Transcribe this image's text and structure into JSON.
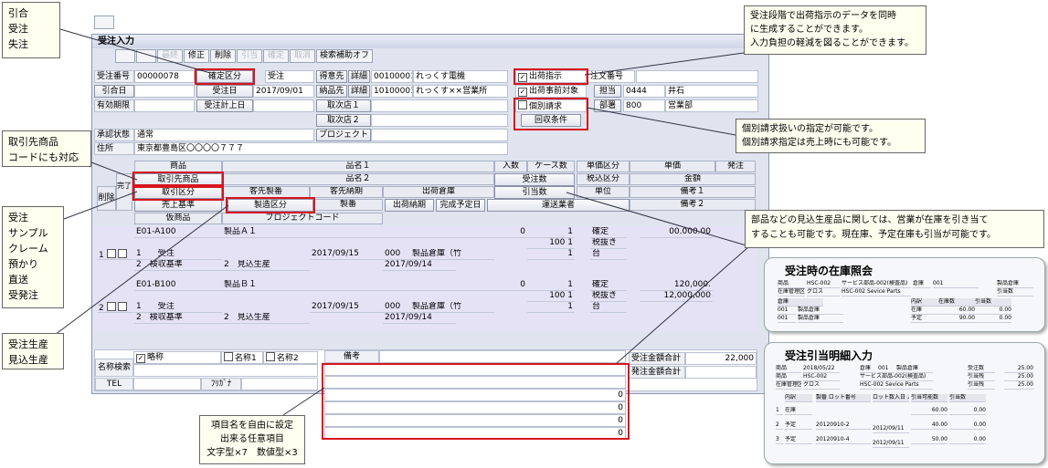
{
  "window": {
    "title": "受注入力",
    "toolbar": [
      "",
      "",
      "最終",
      "修正",
      "削除",
      "引当",
      "確定",
      "取消",
      "検索補助オフ"
    ]
  },
  "header": {
    "order_no_label": "受注番号",
    "order_no": "00000078",
    "kakutei_btn": "確定区分",
    "status": "受注",
    "tokuisaki_btn": "得意先",
    "detail1": "詳細",
    "tokuisaki_code": "00100001",
    "tokuisaki_name": "れっくす電機",
    "shukka_shiji": "出荷指示",
    "chumon_no": "注文番号",
    "hikiate_btn": "引合日",
    "juchu_date_btn": "受注日",
    "juchu_date": "2017/09/01",
    "nohin_btn": "納品先",
    "detail2": "詳細",
    "nohin_code": "10100001",
    "nohin_name": "れっくす××営業所",
    "shukka_taisho": "出荷事前対象",
    "tanto_btn": "担当",
    "tanto_code": "0444",
    "tanto_name": "井石",
    "yuko_label": "有効期限",
    "keijo_btn": "受注計上日",
    "torituki1_btn": "取次店１",
    "kobetsu": "個別請求",
    "bumon_btn": "部署",
    "bumon_code": "800",
    "bumon_name": "営業部",
    "torituki2_btn": "取次店２",
    "kaishu_btn": "回収条件",
    "project_btn": "プロジェクト",
    "shonin_label": "承認状態",
    "shonin_value": "通常",
    "jusho_label": "住所",
    "jusho_value": "東京都豊島区〇〇〇〇７７７"
  },
  "grid_headers": {
    "shohin": "商品",
    "hinmei1": "品名１",
    "irisu": "入数",
    "case": "ケース数",
    "tanka_kubun": "単価区分",
    "tanka": "単価",
    "hatchu": "発注",
    "torihiki_shohin": "取引先商品",
    "hinmei2": "品名２",
    "juchu_su": "受注数",
    "zeikomi": "税込区分",
    "kingaku": "金額",
    "sakujo": "削除",
    "kanryo": "完了",
    "torihiki_kubun": "取引区分",
    "kyaku_seiban": "客先製番",
    "kyaku_noki": "客先納期",
    "shukka_soko": "出荷倉庫",
    "hikiate_su": "引当数",
    "tani": "単位",
    "biko1": "備考１",
    "uriage_kijun": "売上基準",
    "seizo_kubun": "製造区分",
    "seiban": "製番",
    "shukka_noki": "出荷納期",
    "kansei": "完成予定日",
    "unso": "運送業者",
    "biko2": "備考２",
    "kari_shohin": "仮商品",
    "project_code": "プロジェクトコード"
  },
  "rows": [
    {
      "no": "1",
      "code": "E01-A100",
      "name": "製品Ａ１",
      "n1": "0",
      "n2": "0",
      "n3": "1",
      "kakutei": "確定",
      "tanka": "00.000.00",
      "n4": "100",
      "n5": "1",
      "zeinuki": "税抜き",
      "torihiki": "1",
      "torihiki_name": "受注",
      "date1": "2017/09/15",
      "soko_code": "000",
      "soko": "製品倉庫（竹",
      "n6": "0",
      "n7": "1",
      "tani": "台",
      "uriage": "2",
      "uriage_name": "検収基準",
      "seizo": "2",
      "seizo_name": "見込生産",
      "date2": "2017/09/14"
    },
    {
      "no": "2",
      "code": "E01-B100",
      "name": "製品Ｂ１",
      "n1": "0",
      "n2": "0",
      "n3": "1",
      "kakutei": "確定",
      "tanka": "120,000.",
      "n4": "100",
      "n5": "1",
      "zeinuki": "税抜き",
      "kingaku": "12,000,000",
      "torihiki": "1",
      "torihiki_name": "受注",
      "date1": "2017/09/15",
      "soko_code": "000",
      "soko": "製品倉庫（竹",
      "n6": "0",
      "n7": "1",
      "tani": "台",
      "uriage": "2",
      "uriage_name": "検収基準",
      "seizo": "2",
      "seizo_name": "見込生産",
      "date2": "2017/09/14"
    }
  ],
  "footer": {
    "meisho_label": "名称検索",
    "ryakusho": "略称",
    "meisho1": "名称1",
    "meisho2": "名称2",
    "tel": "TEL",
    "furigana": "ﾌﾘｶﾞﾅ",
    "biko": "備考",
    "juchu_total_label": "受注金額合計",
    "juchu_total": "22,000",
    "hatchu_total_label": "発注金額合計",
    "zeros": [
      "0",
      "0",
      "0",
      "0"
    ]
  },
  "notes": {
    "n1": [
      "引合",
      "受注",
      "失注"
    ],
    "n2": [
      "受注段階で出荷指示のデータを同時",
      "に生成することができます。",
      "入力負担の軽減を図ることができます。"
    ],
    "n3": [
      "取引先商品",
      "コードにも対応"
    ],
    "n4": [
      "個別請求扱いの指定が可能です。",
      "個別請求指定は売上時にも可能です。"
    ],
    "n5": [
      "受注",
      "サンプル",
      "クレーム",
      "預かり",
      "直送",
      "受発注"
    ],
    "n6": [
      "部品などの見込生産品に関しては、営業が在庫を引き当て",
      "することも可能です。現在庫、予定在庫も引当が可能です。"
    ],
    "n7": [
      "受注生産",
      "見込生産"
    ],
    "n8": [
      "項目名を自由に設定",
      "出来る任意項目",
      "文字型×7　数値型×3"
    ]
  },
  "shot1": {
    "caption": "受注時の在庫照会",
    "r1": [
      "商品",
      "HSC-002",
      "サービス部品-002(検査品)",
      "倉庫",
      "001",
      "製品倉庫"
    ],
    "r2": [
      "在庫管理区分",
      "グロス",
      "HSC-002 Sevice Parts",
      "",
      "引当数",
      ""
    ],
    "hdr": [
      "倉庫",
      "内訳",
      "在庫数",
      "引当数"
    ],
    "rows": [
      [
        "001",
        "製品倉庫",
        "在庫",
        "60.00",
        "0.00"
      ],
      [
        "001",
        "製品倉庫",
        "予定",
        "90.00",
        "0.00"
      ]
    ]
  },
  "shot2": {
    "caption": "受注引当明細入力",
    "r1": [
      "商品",
      "2018/05/22",
      "倉庫",
      "001",
      "製品倉庫",
      "受注数",
      "25.00"
    ],
    "r2": [
      "商品",
      "HSC-002",
      "サービス部品-002(検査品)",
      "引当残",
      "25.00"
    ],
    "r3": [
      "在庫管理区分",
      "グロス",
      "HSC-002 Sevice Parts",
      "引当残",
      "25.00"
    ],
    "hdr": [
      "内訳",
      "製番 ロット番号",
      "ロット数入日 入庫予定日",
      "引当可能数",
      "引当数"
    ],
    "rows": [
      [
        "1",
        "在庫",
        "",
        "",
        "60.00",
        "0.00"
      ],
      [
        "2",
        "予定",
        "20120910-2",
        "2012/09/11",
        "40.00",
        "0.00"
      ],
      [
        "3",
        "予定",
        "20120910-4",
        "2012/09/11",
        "50.00",
        "0.00"
      ]
    ]
  }
}
